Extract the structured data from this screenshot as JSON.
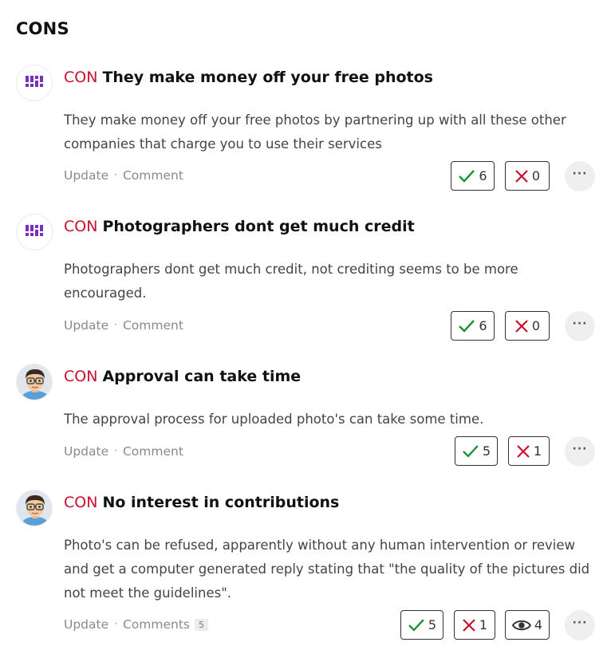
{
  "section_title": "CONS",
  "items": [
    {
      "tag": "CON",
      "title": "They make money off your free photos",
      "body": "They make money off your free photos by partnering up with all these other companies that charge you to use their services",
      "update_label": "Update",
      "comment_label": "Comment",
      "agree": "6",
      "disagree": "0",
      "avatar": "logo-avatar"
    },
    {
      "tag": "CON",
      "title": "Photographers dont get much credit",
      "body": "Photographers dont get much credit, not crediting seems to be more encouraged.",
      "update_label": "Update",
      "comment_label": "Comment",
      "agree": "6",
      "disagree": "0",
      "avatar": "logo-avatar"
    },
    {
      "tag": "CON",
      "title": "Approval can take time",
      "body": "The approval process for uploaded photo's can take some time.",
      "update_label": "Update",
      "comment_label": "Comment",
      "agree": "5",
      "disagree": "1",
      "avatar": "user-avatar"
    },
    {
      "tag": "CON",
      "title": "No interest in contributions",
      "body": "Photo's can be refused, apparently without any human intervention or review and get a computer generated reply stating that \"the quality of the pictures did not meet the guidelines\".",
      "update_label": "Update",
      "comment_label": "Comments",
      "comment_count": "5",
      "agree": "5",
      "disagree": "1",
      "views": "4",
      "avatar": "user-avatar"
    }
  ],
  "colors": {
    "con_tag": "#c8102e",
    "agree_icon": "#1e8f3a",
    "disagree_icon": "#c8102e",
    "logo_purple": "#7b2fbf"
  },
  "icons": {
    "agree": "check-icon",
    "disagree": "x-icon",
    "views": "eye-icon",
    "more": "ellipsis-icon"
  }
}
